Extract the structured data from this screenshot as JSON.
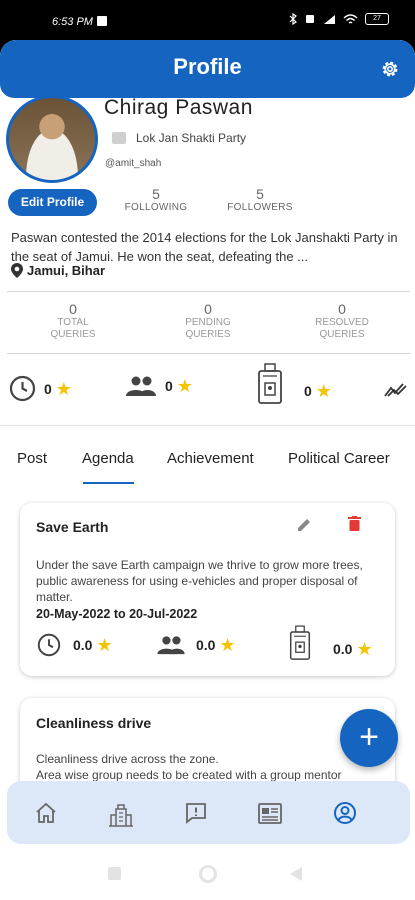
{
  "status_bar": {
    "time": "6:53 PM",
    "battery": "27"
  },
  "header": {
    "title": "Profile",
    "settings_icon": "gear-icon"
  },
  "profile": {
    "name": "Chirag Paswan",
    "party": "Lok Jan Shakti Party",
    "handle": "@amit_shah",
    "edit_label": "Edit Profile",
    "following_count": "5",
    "following_label": "FOLLOWING",
    "followers_count": "5",
    "followers_label": "FOLLOWERS",
    "bio": "Paswan contested the 2014 elections for the Lok Janshakti Party in the seat of Jamui. He won the seat, defeating the ...",
    "location": "Jamui, Bihar"
  },
  "queries": [
    {
      "count": "0",
      "line1": "TOTAL",
      "line2": "QUERIES"
    },
    {
      "count": "0",
      "line1": "PENDING",
      "line2": "QUERIES"
    },
    {
      "count": "0",
      "line1": "RESOLVED",
      "line2": "QUERIES"
    }
  ],
  "ratings": [
    {
      "icon": "clock-icon",
      "value": "0"
    },
    {
      "icon": "people-icon",
      "value": "0"
    },
    {
      "icon": "id-badge-icon",
      "value": "0"
    },
    {
      "icon": "trending-icon"
    }
  ],
  "tabs": [
    "Post",
    "Agenda",
    "Achievement",
    "Political Career"
  ],
  "active_tab": "Agenda",
  "agenda_items": [
    {
      "title": "Save Earth",
      "description": "Under the save Earth campaign we thrive to grow more trees, public awareness for using e-vehicles and proper disposal of matter.",
      "dates": "20-May-2022 to 20-Jul-2022",
      "ratings": [
        "0.0",
        "0.0",
        "0.0"
      ]
    },
    {
      "title": "Cleanliness drive",
      "description": "Cleanliness drive across the zone.",
      "description_cut": "Area wise group needs to be created with a group mentor"
    }
  ],
  "fab_label": "+",
  "bottom_nav": [
    "home-icon",
    "building-icon",
    "feedback-icon",
    "news-icon",
    "profile-icon"
  ],
  "colors": {
    "primary": "#1565c0",
    "star": "#f5c400",
    "nav_bg": "#dce8f8",
    "delete": "#e53935"
  }
}
